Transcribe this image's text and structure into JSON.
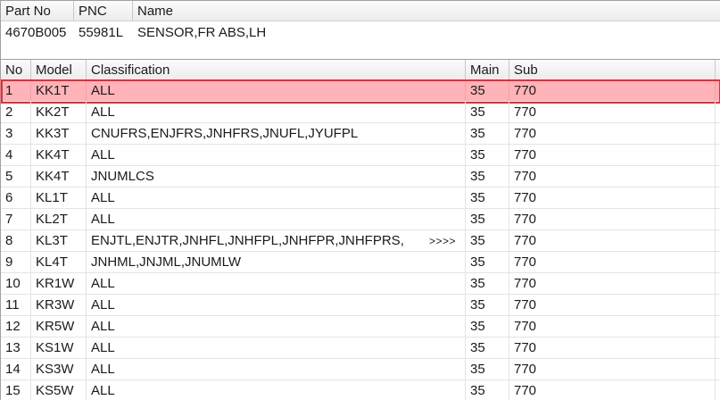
{
  "part_info": {
    "headers": {
      "part_no": "Part No",
      "pnc": "PNC",
      "name": "Name"
    },
    "values": {
      "part_no": "4670B005",
      "pnc": "55981L",
      "name": "SENSOR,FR ABS,LH"
    }
  },
  "model_table": {
    "headers": {
      "no": "No",
      "model": "Model",
      "classification": "Classification",
      "main": "Main",
      "sub": "Sub"
    },
    "more_indicator": ">>>>",
    "selected_row": 0,
    "selection_color": "#ffb3b8",
    "selection_border_color": "#e0303c",
    "rows": [
      {
        "no": "1",
        "model": "KK1T",
        "classification": "ALL",
        "main": "35",
        "sub": "770"
      },
      {
        "no": "2",
        "model": "KK2T",
        "classification": "ALL",
        "main": "35",
        "sub": "770"
      },
      {
        "no": "3",
        "model": "KK3T",
        "classification": "CNUFRS,ENJFRS,JNHFRS,JNUFL,JYUFPL",
        "main": "35",
        "sub": "770"
      },
      {
        "no": "4",
        "model": "KK4T",
        "classification": "ALL",
        "main": "35",
        "sub": "770"
      },
      {
        "no": "5",
        "model": "KK4T",
        "classification": "JNUMLCS",
        "main": "35",
        "sub": "770"
      },
      {
        "no": "6",
        "model": "KL1T",
        "classification": "ALL",
        "main": "35",
        "sub": "770"
      },
      {
        "no": "7",
        "model": "KL2T",
        "classification": "ALL",
        "main": "35",
        "sub": "770"
      },
      {
        "no": "8",
        "model": "KL3T",
        "classification": "ENJTL,ENJTR,JNHFL,JNHFPL,JNHFPR,JNHFPRS,",
        "main": "35",
        "sub": "770",
        "truncated": true
      },
      {
        "no": "9",
        "model": "KL4T",
        "classification": "JNHML,JNJML,JNUMLW",
        "main": "35",
        "sub": "770"
      },
      {
        "no": "10",
        "model": "KR1W",
        "classification": "ALL",
        "main": "35",
        "sub": "770"
      },
      {
        "no": "11",
        "model": "KR3W",
        "classification": "ALL",
        "main": "35",
        "sub": "770"
      },
      {
        "no": "12",
        "model": "KR5W",
        "classification": "ALL",
        "main": "35",
        "sub": "770"
      },
      {
        "no": "13",
        "model": "KS1W",
        "classification": "ALL",
        "main": "35",
        "sub": "770"
      },
      {
        "no": "14",
        "model": "KS3W",
        "classification": "ALL",
        "main": "35",
        "sub": "770"
      },
      {
        "no": "15",
        "model": "KS5W",
        "classification": "ALL",
        "main": "35",
        "sub": "770"
      }
    ]
  }
}
